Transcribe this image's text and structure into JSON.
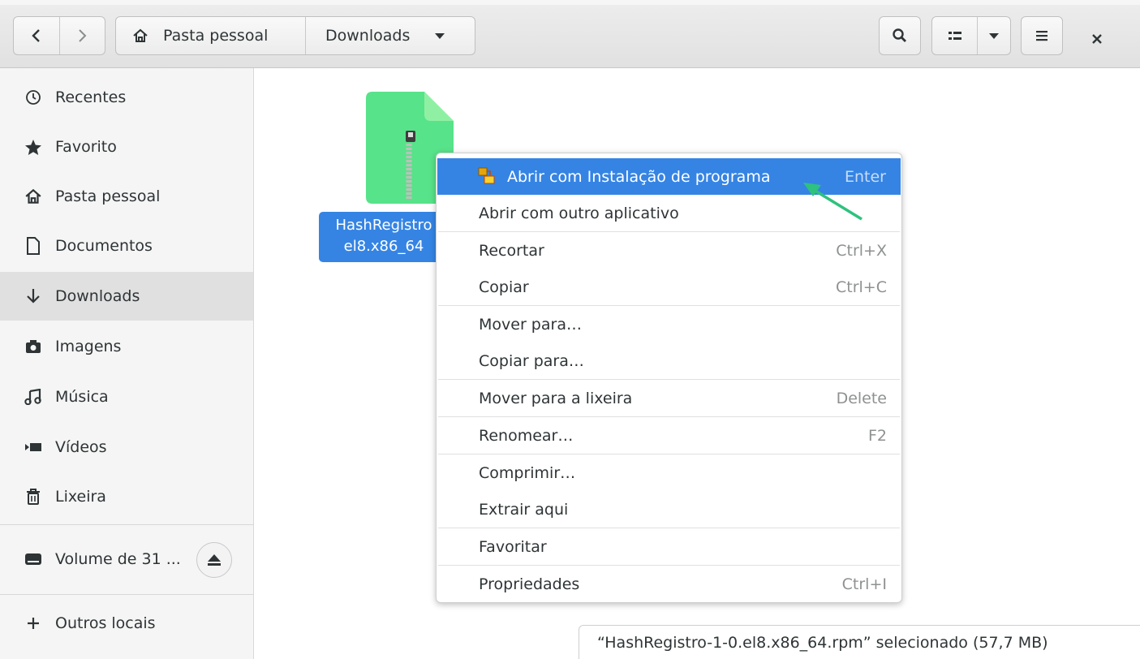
{
  "header": {
    "path_home": "Pasta pessoal",
    "path_current": "Downloads"
  },
  "sidebar": {
    "items": [
      {
        "label": "Recentes",
        "icon": "clock-icon"
      },
      {
        "label": "Favorito",
        "icon": "star-icon"
      },
      {
        "label": "Pasta pessoal",
        "icon": "home-icon"
      },
      {
        "label": "Documentos",
        "icon": "document-icon"
      },
      {
        "label": "Downloads",
        "icon": "download-arrow-icon",
        "active": true
      },
      {
        "label": "Imagens",
        "icon": "camera-icon"
      },
      {
        "label": "Música",
        "icon": "music-icon"
      },
      {
        "label": "Vídeos",
        "icon": "video-icon"
      },
      {
        "label": "Lixeira",
        "icon": "trash-icon"
      },
      {
        "label": "Volume de 31 ...",
        "icon": "drive-icon"
      },
      {
        "label": "Outros locais",
        "icon": "plus-icon"
      }
    ]
  },
  "file": {
    "label_line1": "HashRegistro",
    "label_line2": "el8.x86_64"
  },
  "context_menu": {
    "items": [
      {
        "label": "Abrir com Instalação de programa",
        "accel": "Enter"
      },
      {
        "label": "Abrir com outro aplicativo",
        "accel": ""
      },
      {
        "label": "Recortar",
        "accel": "Ctrl+X"
      },
      {
        "label": "Copiar",
        "accel": "Ctrl+C"
      },
      {
        "label": "Mover para…",
        "accel": ""
      },
      {
        "label": "Copiar para…",
        "accel": ""
      },
      {
        "label": "Mover para a lixeira",
        "accel": "Delete"
      },
      {
        "label": "Renomear…",
        "accel": "F2"
      },
      {
        "label": "Comprimir…",
        "accel": ""
      },
      {
        "label": "Extrair aqui",
        "accel": ""
      },
      {
        "label": "Favoritar",
        "accel": ""
      },
      {
        "label": "Propriedades",
        "accel": "Ctrl+I"
      }
    ]
  },
  "status": {
    "text": "“HashRegistro-1-0.el8.x86_64.rpm” selecionado (57,7 MB)"
  },
  "colors": {
    "accent": "#3584e4",
    "file_green": "#57e389",
    "annotation_arrow": "#2ec27e"
  }
}
